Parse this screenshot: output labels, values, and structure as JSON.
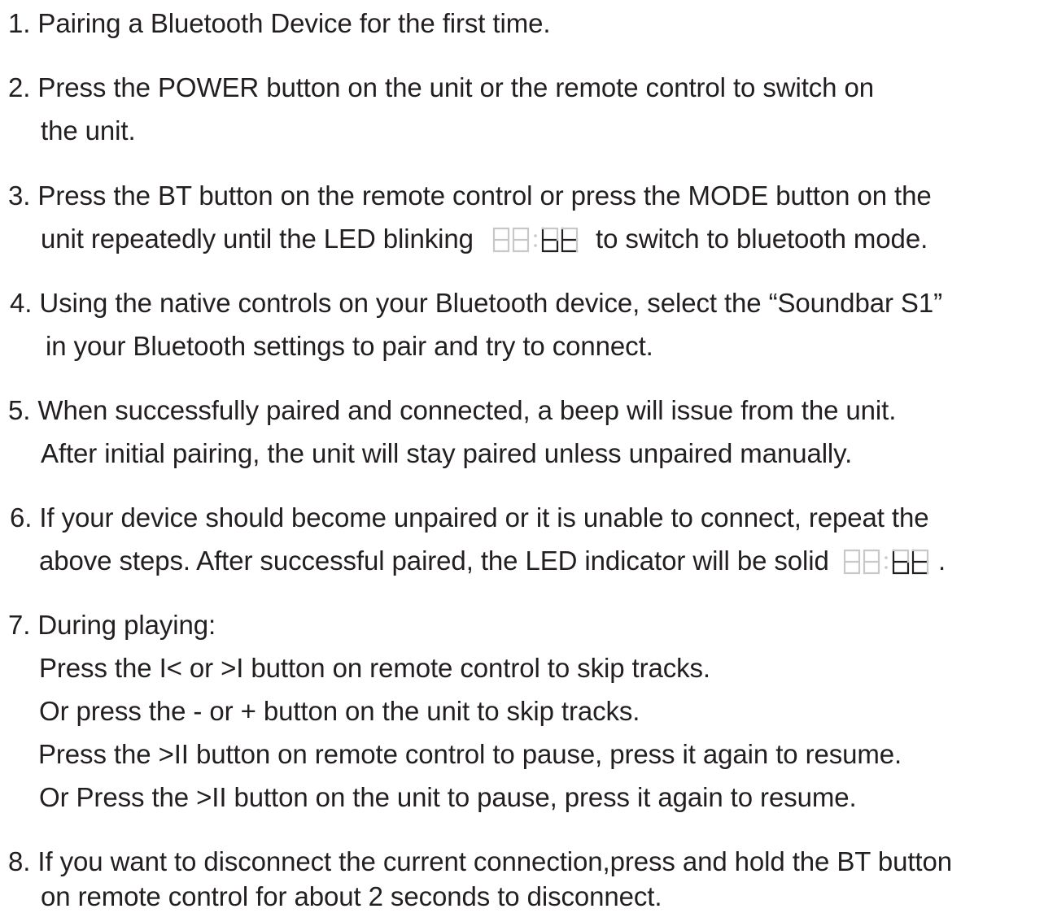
{
  "steps": [
    {
      "number": "1.",
      "lines": [
        "Pairing a Bluetooth Device for the first time."
      ]
    },
    {
      "number": "2.",
      "lines": [
        "Press the POWER button on the unit or the remote control to switch on",
        "the unit."
      ]
    },
    {
      "number": "3.",
      "lines": [
        "Press the BT button on the remote control or press the MODE button on the",
        "unit repeatedly until the LED  blinking",
        "to switch to bluetooth mode."
      ]
    },
    {
      "number": "4.",
      "lines": [
        "Using the native controls on your Bluetooth device, select the “Soundbar S1”",
        "in your Bluetooth settings to pair and try to connect."
      ]
    },
    {
      "number": "5.",
      "lines": [
        "When successfully paired and connected, a beep will issue from the unit.",
        "After initial pairing, the unit will stay paired unless unpaired manually."
      ]
    },
    {
      "number": "6.",
      "lines": [
        "If your device should become unpaired or it is unable to connect, repeat the",
        "above steps. After successful paired, the LED  indicator will be solid",
        "."
      ]
    },
    {
      "number": "7.",
      "lines": [
        "During playing:",
        "Press the I<  or >I  button on remote control to skip tracks.",
        "Or press the - or + button on the unit to skip tracks.",
        "Press the >II button on remote control to pause, press it again to resume.",
        "Or Press the >II button on the unit to pause, press it again to resume."
      ]
    },
    {
      "number": "8.",
      "lines": [
        "If you want to disconnect the current connection,press and hold the BT button",
        "on remote control for about 2 seconds to disconnect."
      ]
    }
  ],
  "led_display_icon": "seven-segment-display-bt-icon",
  "colors": {
    "text": "#231f20",
    "led_dim": "#c8c8c8",
    "led_lit": "#231f20"
  }
}
